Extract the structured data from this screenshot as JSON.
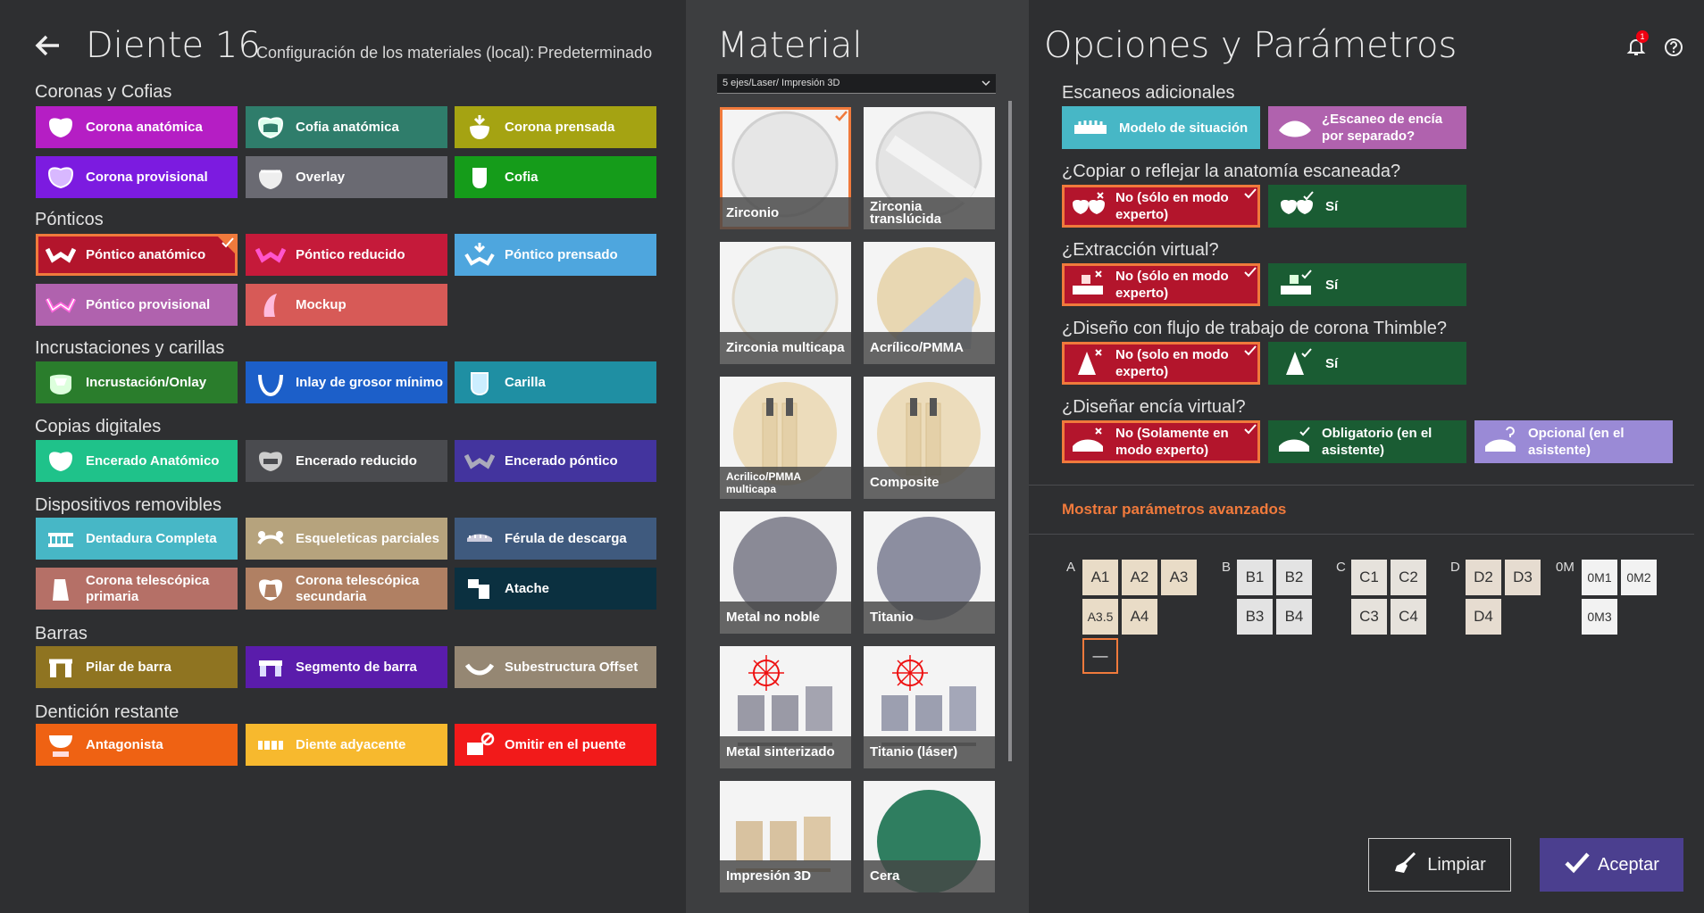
{
  "header": {
    "back_icon": "arrow-left-icon",
    "title": "Diente 16",
    "config_label": "Configuración de los materiales (local):",
    "config_value": "Predeterminado"
  },
  "sections": {
    "coronas": "Coronas y Cofias",
    "ponticos": "Pónticos",
    "incrustaciones": "Incrustaciones y carillas",
    "copias": "Copias digitales",
    "removibles": "Dispositivos removibles",
    "barras": "Barras",
    "denticion": "Dentición restante"
  },
  "buttons": {
    "b1": "Corona anatómica",
    "b2": "Cofia anatómica",
    "b3": "Corona prensada",
    "b4": "Corona provisional",
    "b5": "Overlay",
    "b6": "Cofia",
    "b7": "Póntico anatómico",
    "b8": "Póntico reducido",
    "b9": "Póntico prensado",
    "b10": "Póntico provisional",
    "b11": "Mockup",
    "b12": "Incrustación/Onlay",
    "b13": "Inlay de grosor mínimo",
    "b14": "Carilla",
    "b15": "Encerado Anatómico",
    "b16": "Encerado reducido",
    "b17": "Encerado póntico",
    "b18": "Dentadura Completa",
    "b19": "Esqueleticas parciales",
    "b20": "Férula de descarga",
    "b21": "Corona telescópica primaria",
    "b22": "Corona telescópica secundaria",
    "b23": "Atache",
    "b24": "Pilar de barra",
    "b25": "Segmento de barra",
    "b26": "Subestructura Offset",
    "b27": "Antagonista",
    "b28": "Diente adyacente",
    "b29": "Omitir en el puente"
  },
  "colors": {
    "magenta": "#b51ec4",
    "teal": "#2f7d6b",
    "olive": "#a5a312",
    "violet": "#7c1be0",
    "gray": "#6a6a72",
    "green": "#159c1a",
    "crimson": "#b3152c",
    "red": "#c51a3a",
    "sky": "#4ea6de",
    "pink": "#b062ae",
    "salmon": "#d75a57",
    "dgreen": "#2a7d2c",
    "blue": "#1c5fc9",
    "tealblue": "#1f8fa3",
    "mint": "#1fc28a",
    "dgray": "#4a4b4f",
    "indigo": "#43349e",
    "cyan": "#47b7c6",
    "tan": "#b6a37d",
    "slate": "#3f5a7e",
    "rose": "#b57067",
    "brown": "#b08063",
    "navy": "#0b3040",
    "khaki": "#8f7421",
    "purple": "#5a1cab",
    "taupe": "#958773",
    "orange": "#ef6213",
    "amber": "#f7b92e",
    "bred": "#f21a1a",
    "selected": "#f07a3c"
  },
  "material": {
    "title": "Material",
    "select_value": "5 ejes/Laser/ Impresión 3D",
    "tiles": [
      "Zirconio",
      "Zirconia translúcida",
      "Zirconia multicapa",
      "Acrílico/PMMA",
      "Acrilico/PMMA multicapa",
      "Composite",
      "Metal no noble",
      "Titanio",
      "Metal sinterizado",
      "Titanio (láser)",
      "Impresión 3D",
      "Cera"
    ]
  },
  "options": {
    "title": "Opciones y Parámetros",
    "notif_count": "1",
    "q_scans": "Escaneos adicionales",
    "scan1": "Modelo de situación",
    "scan2": "¿Escaneo de encía por separado?",
    "q_copy": "¿Copiar o reflejar la anatomía escaneada?",
    "copy_no": "No (sólo en modo experto)",
    "copy_yes": "Sí",
    "q_extract": "¿Extracción virtual?",
    "extract_no": "No (sólo en modo experto)",
    "extract_yes": "Sí",
    "q_thimble": "¿Diseño con flujo de trabajo de corona Thimble?",
    "thimble_no": "No (solo en modo experto)",
    "thimble_yes": "Sí",
    "q_gingiva": "¿Diseñar encía virtual?",
    "ging1": "No (Solamente en modo experto)",
    "ging2": "Obligatorio (en el asistente)",
    "ging3": "Opcional (en el asistente)",
    "advanced": "Mostrar parámetros avanzados"
  },
  "shades": {
    "ga": "A",
    "gb": "B",
    "gc": "C",
    "gd": "D",
    "gom": "0M",
    "a": [
      "A1",
      "A2",
      "A3",
      "A3.5",
      "A4"
    ],
    "b": [
      "B1",
      "B2",
      "B3",
      "B4"
    ],
    "c": [
      "C1",
      "C2",
      "C3",
      "C4"
    ],
    "d": [
      "D2",
      "D3",
      "D4"
    ],
    "om": [
      "0M1",
      "0M2",
      "0M3"
    ],
    "none": "—"
  },
  "footer": {
    "clear": "Limpiar",
    "accept": "Aceptar"
  }
}
